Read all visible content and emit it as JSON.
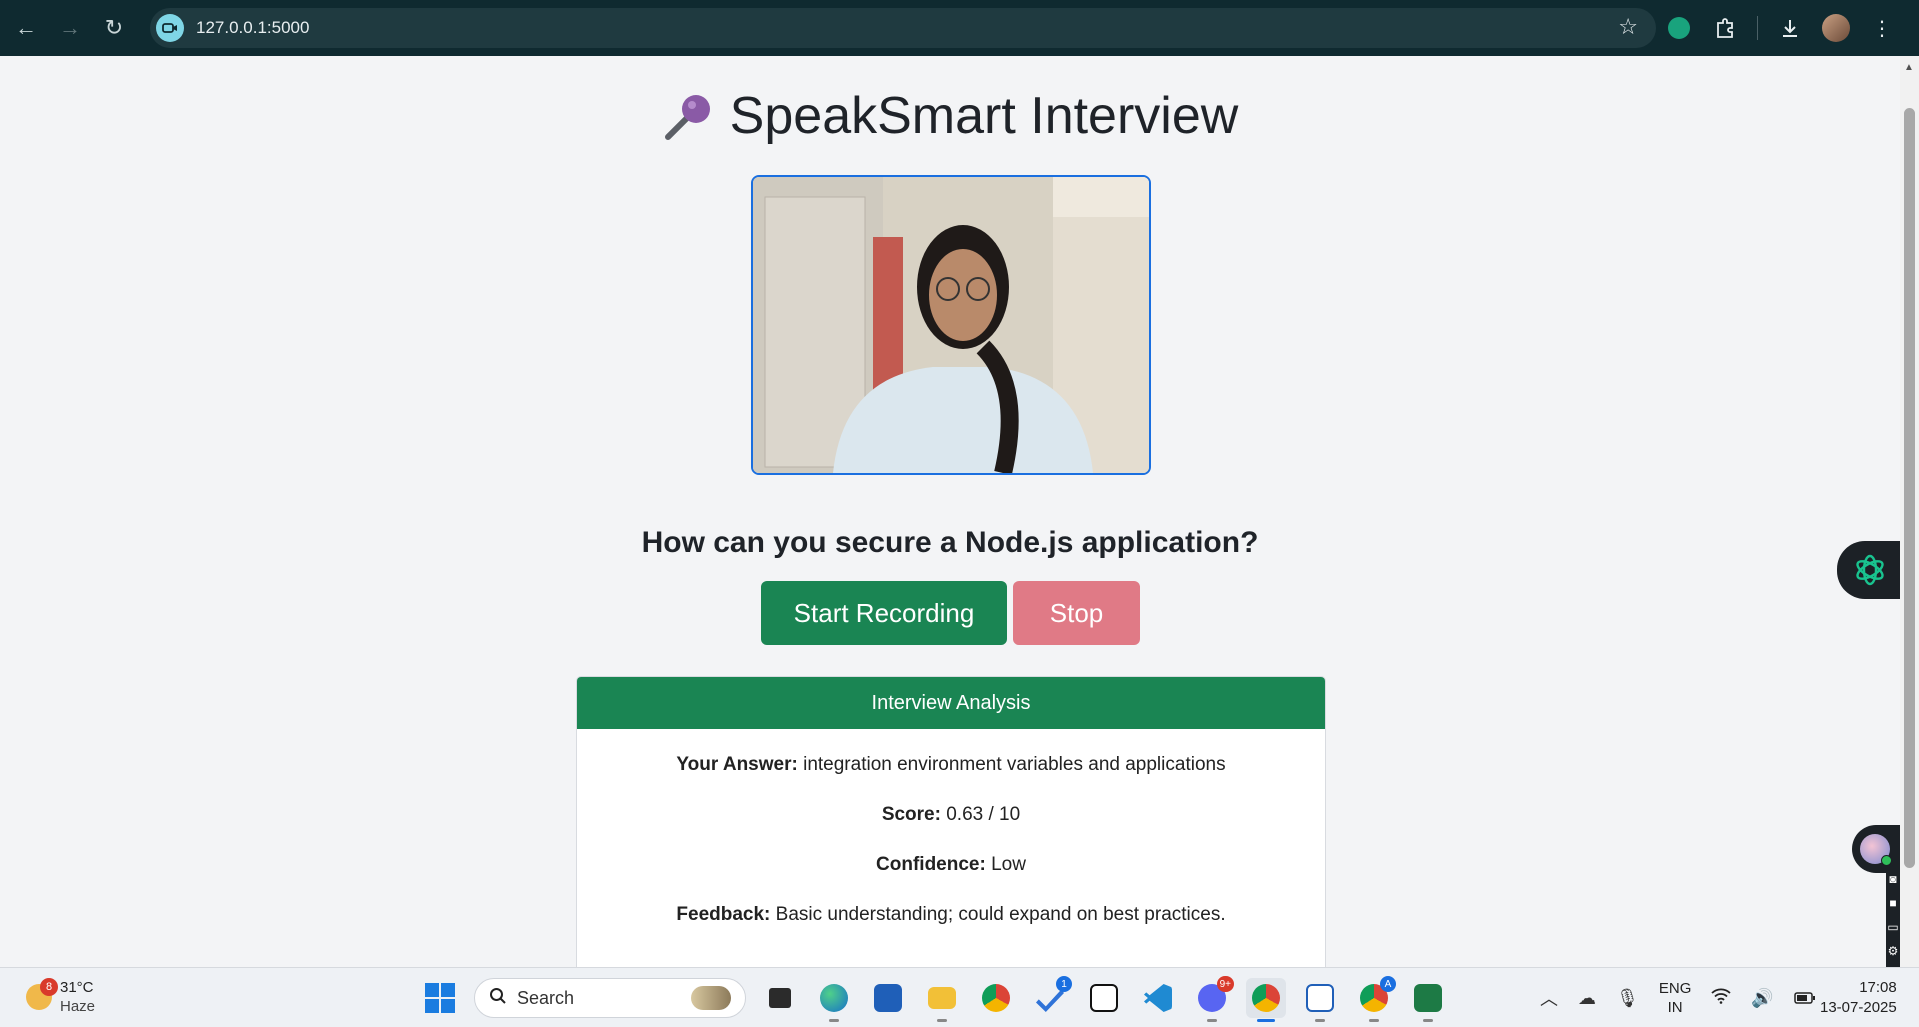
{
  "browser": {
    "url": "127.0.0.1:5000",
    "back_icon": "arrow-left-icon",
    "forward_icon": "arrow-right-icon",
    "reload_icon": "reload-icon"
  },
  "page": {
    "title": "SpeakSmart Interview",
    "title_icon": "microphone-icon",
    "question": "How can you secure a Node.js application?",
    "start_label": "Start Recording",
    "stop_label": "Stop",
    "analysis": {
      "header": "Interview Analysis",
      "answer_label": "Your Answer:",
      "answer_value": "integration environment variables and applications",
      "score_label": "Score:",
      "score_value": "0.63 / 10",
      "confidence_label": "Confidence:",
      "confidence_value": "Low",
      "feedback_label": "Feedback:",
      "feedback_value": "Basic understanding; could expand on best practices."
    }
  },
  "taskbar": {
    "weather_badge": "8",
    "temperature": "31°C",
    "condition": "Haze",
    "search_placeholder": "Search",
    "todo_badge": "1",
    "discord_badge": "9+",
    "chrome_profile_badge": "A",
    "lang_line1": "ENG",
    "lang_line2": "IN",
    "time": "17:08",
    "date": "13-07-2025"
  },
  "colors": {
    "primary_green": "#1a8553",
    "stop_red": "#e07a86",
    "video_border": "#1a6fe0"
  }
}
